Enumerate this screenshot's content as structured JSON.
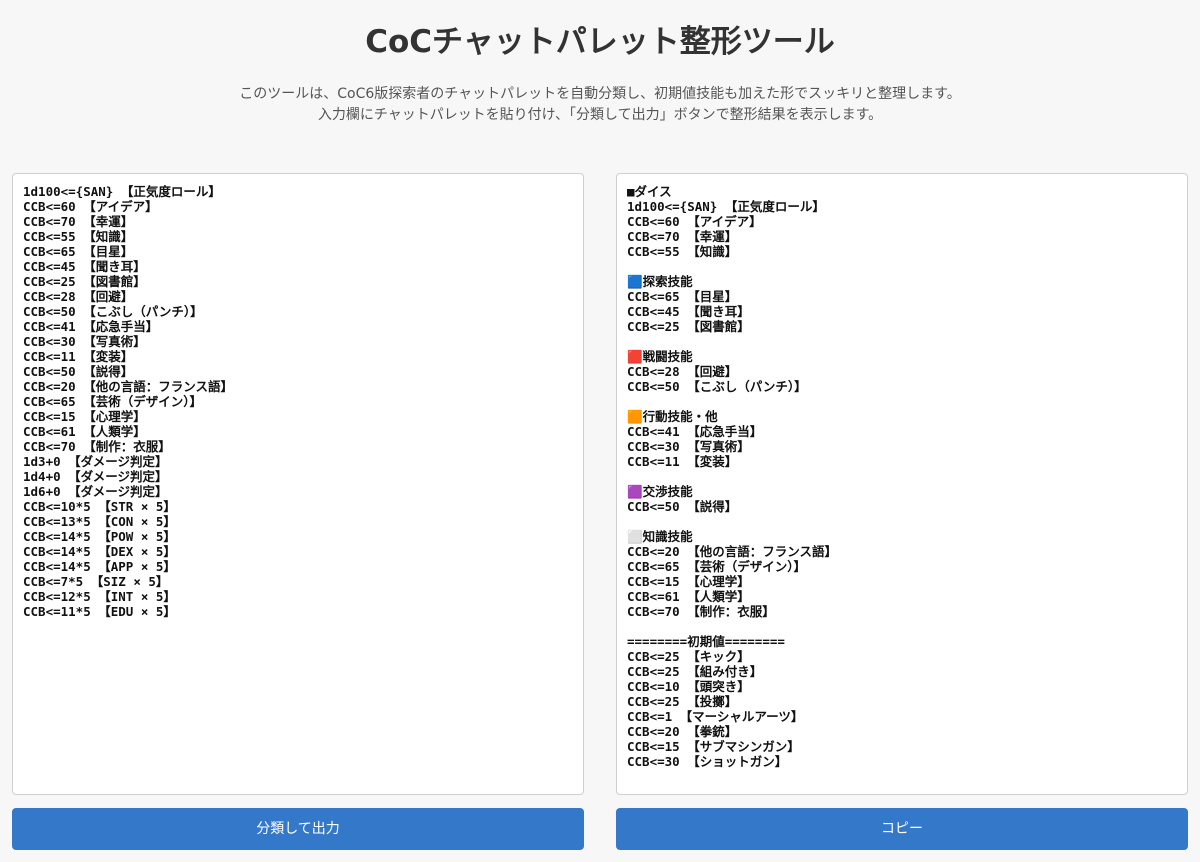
{
  "header": {
    "title": "CoCチャットパレット整形ツール",
    "description_line1": "このツールは、CoC6版探索者のチャットパレットを自動分類し、初期値技能も加えた形でスッキリと整理します。",
    "description_line2": "入力欄にチャットパレットを貼り付け、「分類して出力」ボタンで整形結果を表示します。"
  },
  "input": {
    "value": "1d100<={SAN} 【正気度ロール】\nCCB<=60 【アイデア】\nCCB<=70 【幸運】\nCCB<=55 【知識】\nCCB<=65 【目星】\nCCB<=45 【聞き耳】\nCCB<=25 【図書館】\nCCB<=28 【回避】\nCCB<=50 【こぶし（パンチ）】\nCCB<=41 【応急手当】\nCCB<=30 【写真術】\nCCB<=11 【変装】\nCCB<=50 【説得】\nCCB<=20 【他の言語：フランス語】\nCCB<=65 【芸術（デザイン）】\nCCB<=15 【心理学】\nCCB<=61 【人類学】\nCCB<=70 【制作：衣服】\n1d3+0 【ダメージ判定】\n1d4+0 【ダメージ判定】\n1d6+0 【ダメージ判定】\nCCB<=10*5 【STR × 5】\nCCB<=13*5 【CON × 5】\nCCB<=14*5 【POW × 5】\nCCB<=14*5 【DEX × 5】\nCCB<=14*5 【APP × 5】\nCCB<=7*5 【SIZ × 5】\nCCB<=12*5 【INT × 5】\nCCB<=11*5 【EDU × 5】"
  },
  "output": {
    "value": "■ダイス\n1d100<={SAN} 【正気度ロール】\nCCB<=60 【アイデア】\nCCB<=70 【幸運】\nCCB<=55 【知識】\n\n🟦探索技能\nCCB<=65 【目星】\nCCB<=45 【聞き耳】\nCCB<=25 【図書館】\n\n🟥戦闘技能\nCCB<=28 【回避】\nCCB<=50 【こぶし（パンチ）】\n\n🟧行動技能・他\nCCB<=41 【応急手当】\nCCB<=30 【写真術】\nCCB<=11 【変装】\n\n🟪交渉技能\nCCB<=50 【説得】\n\n⬜知識技能\nCCB<=20 【他の言語：フランス語】\nCCB<=65 【芸術（デザイン）】\nCCB<=15 【心理学】\nCCB<=61 【人類学】\nCCB<=70 【制作：衣服】\n\n========初期値========\nCCB<=25 【キック】\nCCB<=25 【組み付き】\nCCB<=10 【頭突き】\nCCB<=25 【投擲】\nCCB<=1 【マーシャルアーツ】\nCCB<=20 【拳銃】\nCCB<=15 【サブマシンガン】\nCCB<=30 【ショットガン】"
  },
  "buttons": {
    "classify_label": "分類して出力",
    "copy_label": "コピー"
  },
  "colors": {
    "button_bg": "#3478c9",
    "page_bg": "#f7f7f7"
  }
}
